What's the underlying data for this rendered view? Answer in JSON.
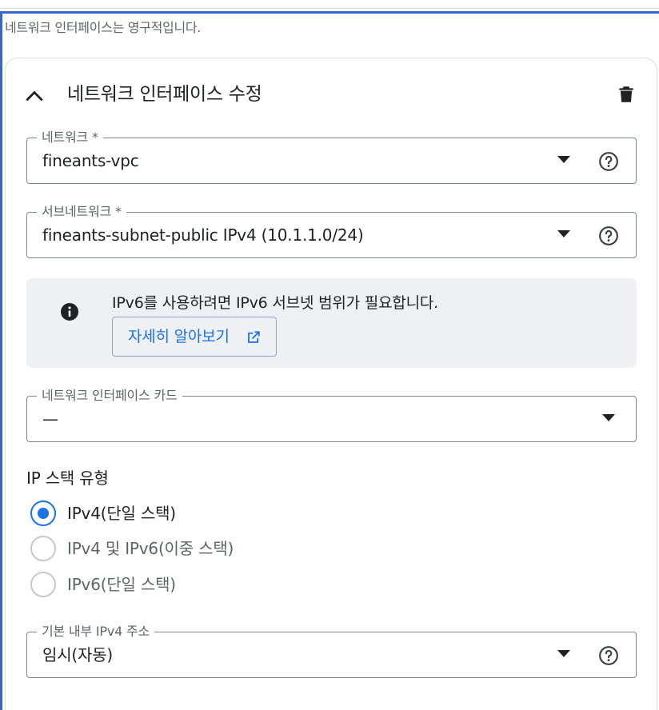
{
  "top_note": "네트워크 인터페이스는 영구적입니다.",
  "colors": {
    "accent": "#1a73e8",
    "frame_blue": "#3367d6",
    "info_bg": "#eef0f3",
    "text": "#202124",
    "secondary_text": "#5f6368"
  },
  "panel": {
    "title": "네트워크 인터페이스 수정",
    "collapse_icon": "chevron-up-icon",
    "delete_icon": "trash-icon"
  },
  "network": {
    "label": "네트워크 *",
    "value": "fineants-vpc",
    "help_icon": "help-circle-icon"
  },
  "subnetwork": {
    "label": "서브네트워크 *",
    "value": "fineants-subnet-public IPv4 (10.1.1.0/24)",
    "help_icon": "help-circle-icon"
  },
  "info": {
    "icon": "info-icon",
    "text": "IPv6를 사용하려면 IPv6 서브넷 범위가 필요합니다.",
    "learn_more": "자세히 알아보기",
    "external_icon": "open-in-new-icon"
  },
  "nic": {
    "label": "네트워크 인터페이스 카드",
    "value": "—"
  },
  "ip_stack": {
    "title": "IP 스택 유형",
    "options": [
      {
        "label": "IPv4(단일 스택)",
        "selected": true
      },
      {
        "label": "IPv4 및 IPv6(이중 스택)",
        "selected": false
      },
      {
        "label": "IPv6(단일 스택)",
        "selected": false
      }
    ]
  },
  "internal_ipv4": {
    "label": "기본 내부 IPv4 주소",
    "value": "임시(자동)",
    "help_icon": "help-circle-icon"
  }
}
